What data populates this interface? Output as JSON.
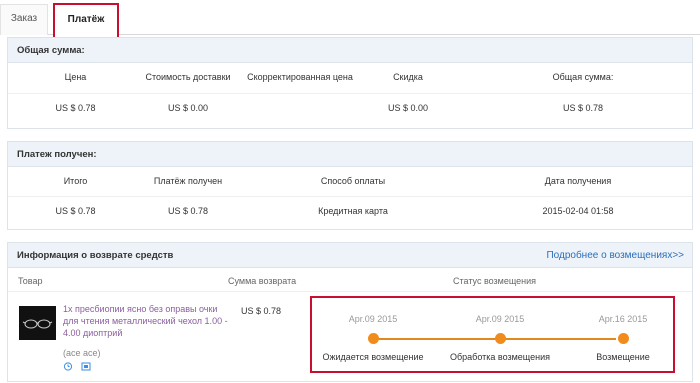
{
  "tabs": {
    "order": "Заказ",
    "payment": "Платёж"
  },
  "summary": {
    "title": "Общая сумма:",
    "headers": [
      "Цена",
      "Стоимость доставки",
      "Скорректированная цена",
      "Скидка",
      "Общая сумма:"
    ],
    "values": [
      "US $ 0.78",
      "US $ 0.00",
      "",
      "US $ 0.00",
      "US $ 0.78"
    ]
  },
  "received": {
    "title": "Платеж получен:",
    "headers": [
      "Итого",
      "Платёж получен",
      "Способ оплаты",
      "Дата получения"
    ],
    "values": [
      "US $ 0.78",
      "US $ 0.78",
      "Кредитная карта",
      "2015-02-04 01:58"
    ]
  },
  "refund": {
    "title": "Информация о возврате средств",
    "more_link": "Подробнее о возмещениях>>",
    "col_product": "Товар",
    "col_amount": "Сумма возврата",
    "col_status": "Статус возмещения",
    "item": {
      "title": "1х пресбиопии ясно без оправы очки для чтения металлический чехол 1.00 - 4.00 диоптрий",
      "sku": "(ace ace)",
      "amount": "US $ 0.78"
    },
    "timeline": [
      {
        "date": "Apr.09 2015",
        "label": "Ожидается возмещение"
      },
      {
        "date": "Apr.09 2015",
        "label": "Обработка возмещения"
      },
      {
        "date": "Apr.16 2015",
        "label": "Возмещение"
      }
    ],
    "accent_color": "#f08c1e",
    "highlight_color": "#c8102e"
  }
}
